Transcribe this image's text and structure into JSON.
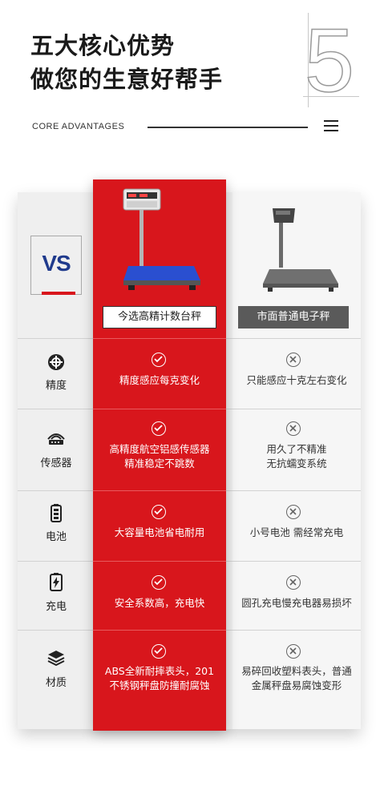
{
  "header": {
    "title_line1": "五大核心优势",
    "title_line2": "做您的生意好帮手",
    "number": "5",
    "subtitle": "CORE ADVANTAGES"
  },
  "comparison": {
    "vs_label": "VS",
    "ours_label": "今选高精计数台秤",
    "theirs_label": "市面普通电子秤",
    "rows": [
      {
        "feature": "精度",
        "icon": "precision-icon",
        "ours": "精度感应每克变化",
        "theirs": "只能感应十克左右变化"
      },
      {
        "feature": "传感器",
        "icon": "sensor-icon",
        "ours_line1": "高精度航空铝感传感器",
        "ours_line2": "精准稳定不跳数",
        "theirs_line1": "用久了不精准",
        "theirs_line2": "无抗蠕变系统"
      },
      {
        "feature": "电池",
        "icon": "battery-icon",
        "ours": "大容量电池省电耐用",
        "theirs": "小号电池 需经常充电"
      },
      {
        "feature": "充电",
        "icon": "charging-icon",
        "ours": "安全系数高，充电快",
        "theirs": "圆孔充电慢充电器易损坏"
      },
      {
        "feature": "材质",
        "icon": "layers-icon",
        "ours_line1": "ABS全新耐摔表头，201",
        "ours_line2": "不锈钢秤盘防撞耐腐蚀",
        "theirs_line1": "易碎回收塑料表头，普通",
        "theirs_line2": "金属秤盘易腐蚀变形"
      }
    ]
  },
  "colors": {
    "accent": "#d8161c",
    "vs_blue": "#1f3a8c",
    "gray_label": "#5a5a5a"
  }
}
